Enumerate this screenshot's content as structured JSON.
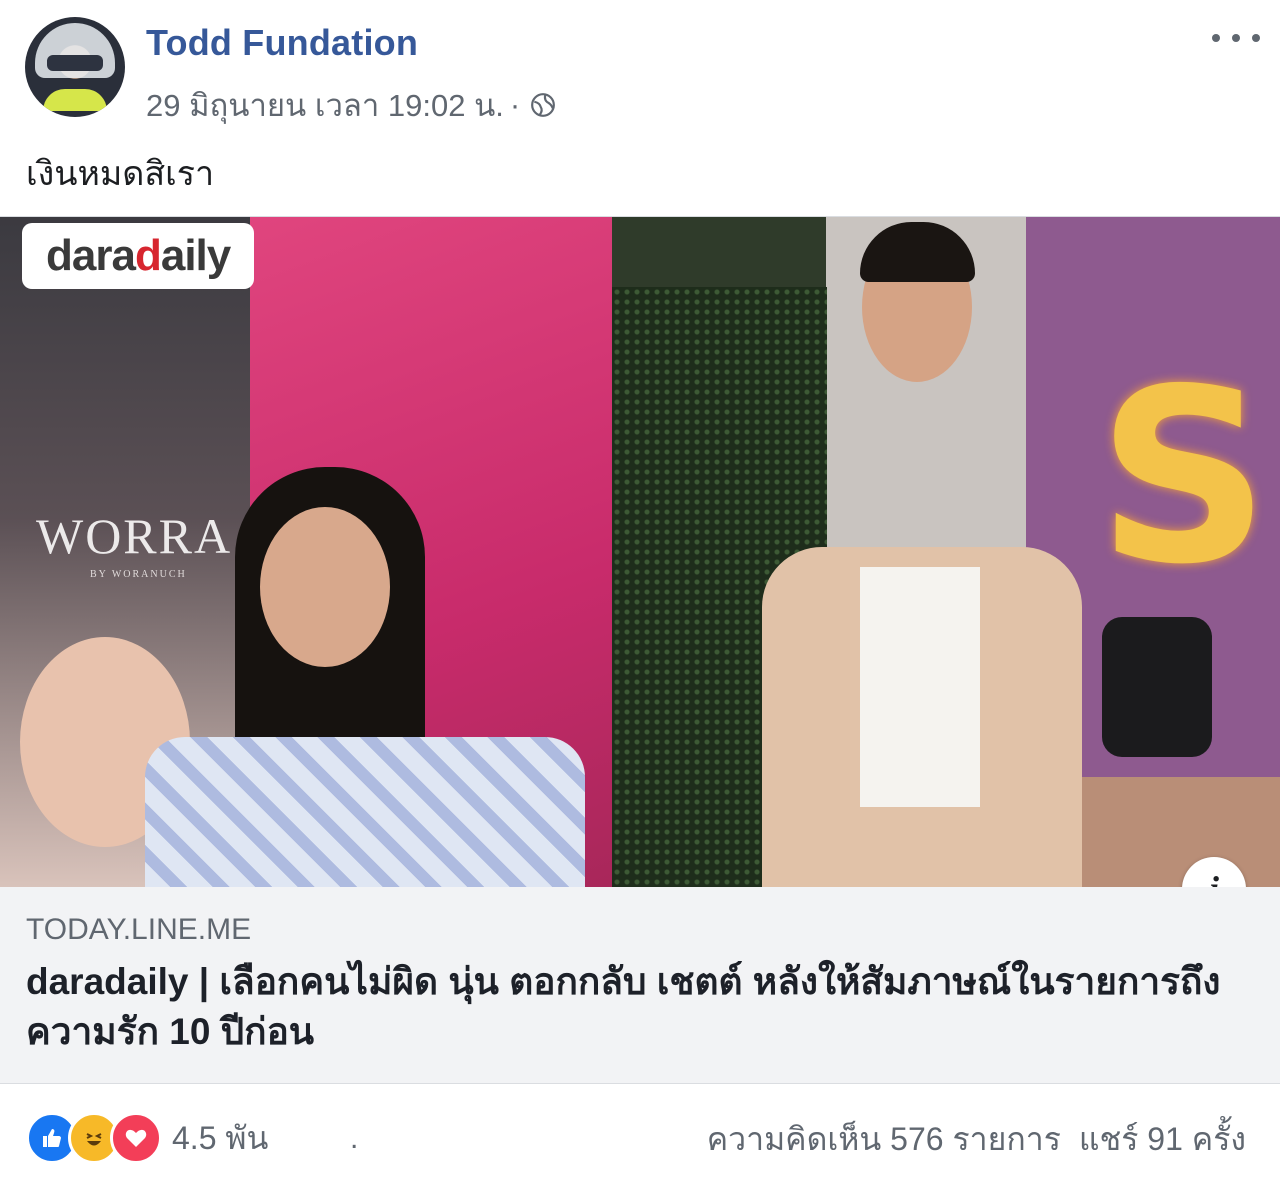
{
  "post": {
    "author": "Todd Fundation",
    "timestamp": "29 มิถุนายน เวลา 19:02 น.",
    "separator": "·",
    "privacy_icon": "globe-icon",
    "text": "เงินหมดสิเรา"
  },
  "link": {
    "image_badge": {
      "brand_part1": "dara",
      "brand_part2": "d",
      "brand_part3": "aily"
    },
    "poster_title": "WORRA",
    "poster_sub": "BY WORANUCH",
    "sign_letter": "S",
    "info_symbol": "i",
    "domain": "TODAY.LINE.ME",
    "title": "daradaily | เลือกคนไม่ผิด นุ่น ตอกกลับ เชตต์ หลังให้สัมภาษณ์ในรายการถึงความรัก 10 ปีก่อน"
  },
  "footer": {
    "reactions": [
      "like-icon",
      "haha-icon",
      "love-icon"
    ],
    "reaction_count": "4.5 พัน",
    "dot": ".",
    "comments": "ความคิดเห็น 576 รายการ",
    "shares": "แชร์ 91 ครั้ง"
  },
  "colors": {
    "author": "#365899",
    "secondary_text": "#606770",
    "link_bg": "#f2f3f5",
    "like": "#1877f2",
    "haha": "#f7b928",
    "love": "#f33e58"
  }
}
